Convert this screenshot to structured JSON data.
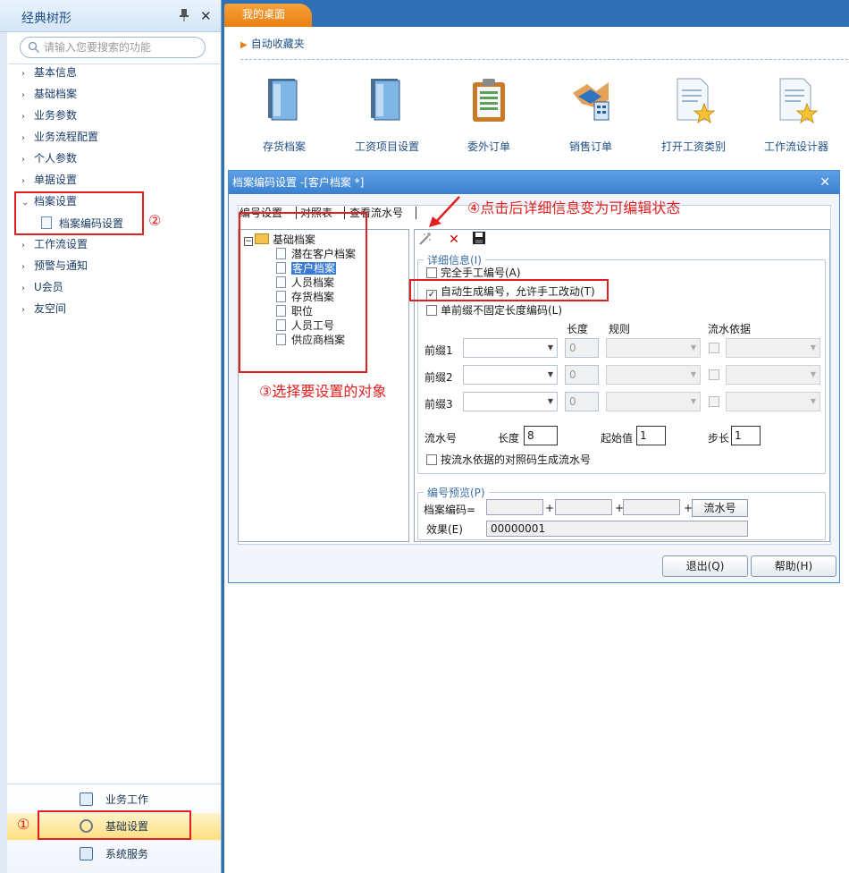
{
  "sidebar": {
    "title": "经典树形",
    "search_placeholder": "请输入您要搜索的功能",
    "items": [
      {
        "label": "基本信息"
      },
      {
        "label": "基础档案"
      },
      {
        "label": "业务参数"
      },
      {
        "label": "业务流程配置"
      },
      {
        "label": "个人参数"
      },
      {
        "label": "单据设置"
      },
      {
        "label": "档案设置"
      },
      {
        "label": "工作流设置"
      },
      {
        "label": "预警与通知"
      },
      {
        "label": "U会员"
      },
      {
        "label": "友空间"
      }
    ],
    "sub_item": "档案编码设置",
    "bottom": {
      "business": "业务工作",
      "base": "基础设置",
      "system": "系统服务"
    }
  },
  "annotations": {
    "n1": "①",
    "n2": "②",
    "n3": "③选择要设置的对象",
    "n4": "④点击后详细信息变为可编辑状态"
  },
  "main": {
    "tab": "我的桌面",
    "favorites": "自动收藏夹",
    "shortcuts": [
      {
        "label": "存货档案"
      },
      {
        "label": "工资项目设置"
      },
      {
        "label": "委外订单"
      },
      {
        "label": "销售订单"
      },
      {
        "label": "打开工资类别"
      },
      {
        "label": "工作流设计器"
      }
    ]
  },
  "dialog": {
    "title": "档案编码设置 -[客户档案 *]",
    "tabs": [
      "编号设置",
      "对照表",
      "查看流水号"
    ],
    "tree": {
      "root": "基础档案",
      "children": [
        "潜在客户档案",
        "客户档案",
        "人员档案",
        "存货档案",
        "职位",
        "人员工号",
        "供应商档案"
      ]
    },
    "detail_legend": "详细信息(I)",
    "opt_manual": "完全手工编号(A)",
    "opt_auto": "自动生成编号，允许手工改动(T)",
    "opt_prefix": "单前缀不固定长度编码(L)",
    "col_length": "长度",
    "col_rule": "规则",
    "col_serial": "流水依据",
    "prefix1": "前缀1",
    "prefix2": "前缀2",
    "prefix3": "前缀3",
    "prefix_len": "0",
    "serial_label": "流水号",
    "length_label": "长度",
    "length_value": "8",
    "start_label": "起始值",
    "start_value": "1",
    "step_label": "步长",
    "step_value": "1",
    "opt_ref": "按流水依据的对照码生成流水号",
    "preview_legend": "编号预览(P)",
    "code_label": "档案编码=",
    "plus": "+",
    "serial_btn": "流水号",
    "effect_label": "效果(E)",
    "effect_value": "00000001",
    "exit_btn": "退出(Q)",
    "help_btn": "帮助(H)"
  }
}
